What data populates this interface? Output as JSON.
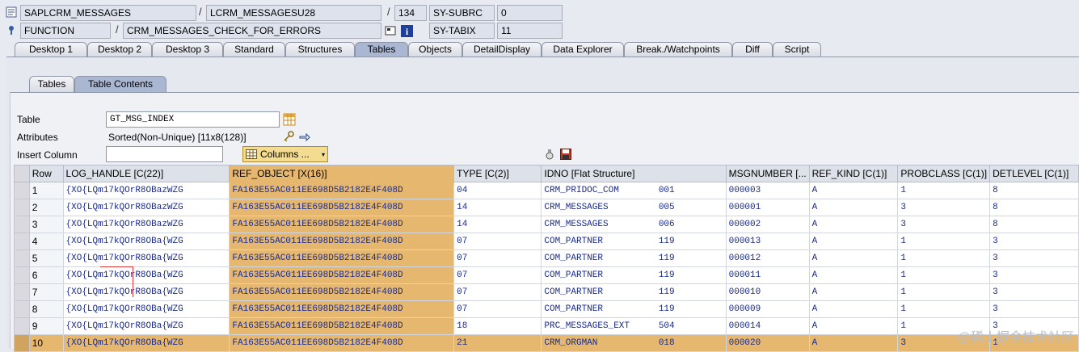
{
  "header": {
    "row1": {
      "program": "SAPLCRM_MESSAGES",
      "include": "LCRM_MESSAGESU28",
      "line": "134",
      "sysvar": "SY-SUBRC",
      "sysval": "0"
    },
    "row2": {
      "type": "FUNCTION",
      "name": "CRM_MESSAGES_CHECK_FOR_ERRORS",
      "sysvar": "SY-TABIX",
      "sysval": "11"
    },
    "separator": "/"
  },
  "tabs": [
    "Desktop 1",
    "Desktop 2",
    "Desktop 3",
    "Standard",
    "Structures",
    "Tables",
    "Objects",
    "DetailDisplay",
    "Data Explorer",
    "Break./Watchpoints",
    "Diff",
    "Script"
  ],
  "active_tab": "Tables",
  "subtabs": [
    "Tables",
    "Table Contents"
  ],
  "active_subtab": "Table Contents",
  "form": {
    "table_label": "Table",
    "table_value": "GT_MSG_INDEX",
    "attributes_label": "Attributes",
    "attributes_value": "Sorted(Non-Unique) [11x8(128)]",
    "insert_label": "Insert Column",
    "insert_value": "",
    "columns_button": "Columns ..."
  },
  "grid": {
    "columns": [
      "Row",
      "LOG_HANDLE [C(22)]",
      "REF_OBJECT [X(16)]",
      "TYPE [C(2)]",
      "IDNO [Flat Structure]",
      "MSGNUMBER [...",
      "REF_KIND [C(1)]",
      "PROBCLASS [C(1)]",
      "DETLEVEL [C(1)]"
    ],
    "rows": [
      {
        "row": "1",
        "log": "{XO{LQm17kQOrR8OBazWZG",
        "ref": "FA163E55AC011EE698D5B2182E4F408D",
        "type": "04",
        "id": "CRM_PRIDOC_COM",
        "no": "001",
        "msgnum": "000003",
        "kind": "A",
        "prob": "1",
        "det": "8"
      },
      {
        "row": "2",
        "log": "{XO{LQm17kQOrR8OBazWZG",
        "ref": "FA163E55AC011EE698D5B2182E4F408D",
        "type": "14",
        "id": "CRM_MESSAGES",
        "no": "005",
        "msgnum": "000001",
        "kind": "A",
        "prob": "3",
        "det": "8"
      },
      {
        "row": "3",
        "log": "{XO{LQm17kQOrR8OBazWZG",
        "ref": "FA163E55AC011EE698D5B2182E4F408D",
        "type": "14",
        "id": "CRM_MESSAGES",
        "no": "006",
        "msgnum": "000002",
        "kind": "A",
        "prob": "3",
        "det": "8"
      },
      {
        "row": "4",
        "log": "{XO{LQm17kQOrR8OBa{WZG",
        "ref": "FA163E55AC011EE698D5B2182E4F408D",
        "type": "07",
        "id": "COM_PARTNER",
        "no": "119",
        "msgnum": "000013",
        "kind": "A",
        "prob": "1",
        "det": "3"
      },
      {
        "row": "5",
        "log": "{XO{LQm17kQOrR8OBa{WZG",
        "ref": "FA163E55AC011EE698D5B2182E4F408D",
        "type": "07",
        "id": "COM_PARTNER",
        "no": "119",
        "msgnum": "000012",
        "kind": "A",
        "prob": "1",
        "det": "3"
      },
      {
        "row": "6",
        "log": "{XO{LQm17kQOrR8OBa{WZG",
        "ref": "FA163E55AC011EE698D5B2182E4F408D",
        "type": "07",
        "id": "COM_PARTNER",
        "no": "119",
        "msgnum": "000011",
        "kind": "A",
        "prob": "1",
        "det": "3"
      },
      {
        "row": "7",
        "log": "{XO{LQm17kQOrR8OBa{WZG",
        "ref": "FA163E55AC011EE698D5B2182E4F408D",
        "type": "07",
        "id": "COM_PARTNER",
        "no": "119",
        "msgnum": "000010",
        "kind": "A",
        "prob": "1",
        "det": "3"
      },
      {
        "row": "8",
        "log": "{XO{LQm17kQOrR8OBa{WZG",
        "ref": "FA163E55AC011EE698D5B2182E4F408D",
        "type": "07",
        "id": "COM_PARTNER",
        "no": "119",
        "msgnum": "000009",
        "kind": "A",
        "prob": "1",
        "det": "3"
      },
      {
        "row": "9",
        "log": "{XO{LQm17kQOrR8OBa{WZG",
        "ref": "FA163E55AC011EE698D5B2182E4F408D",
        "type": "18",
        "id": "PRC_MESSAGES_EXT",
        "no": "504",
        "msgnum": "000014",
        "kind": "A",
        "prob": "1",
        "det": "3"
      },
      {
        "row": "10",
        "log": "{XO{LQm17kQOrR8OBa{WZG",
        "ref": "FA163E55AC011EE698D5B2182E4F408D",
        "type": "21",
        "id": "CRM_ORGMAN",
        "no": "018",
        "msgnum": "000020",
        "kind": "A",
        "prob": "3",
        "det": "1"
      }
    ]
  },
  "colors": {
    "highlight": "#e6b86f",
    "active_tab": "#aab7d3",
    "value_text": "#1a2b8c"
  },
  "watermark": "@稀土掘金技术社区"
}
